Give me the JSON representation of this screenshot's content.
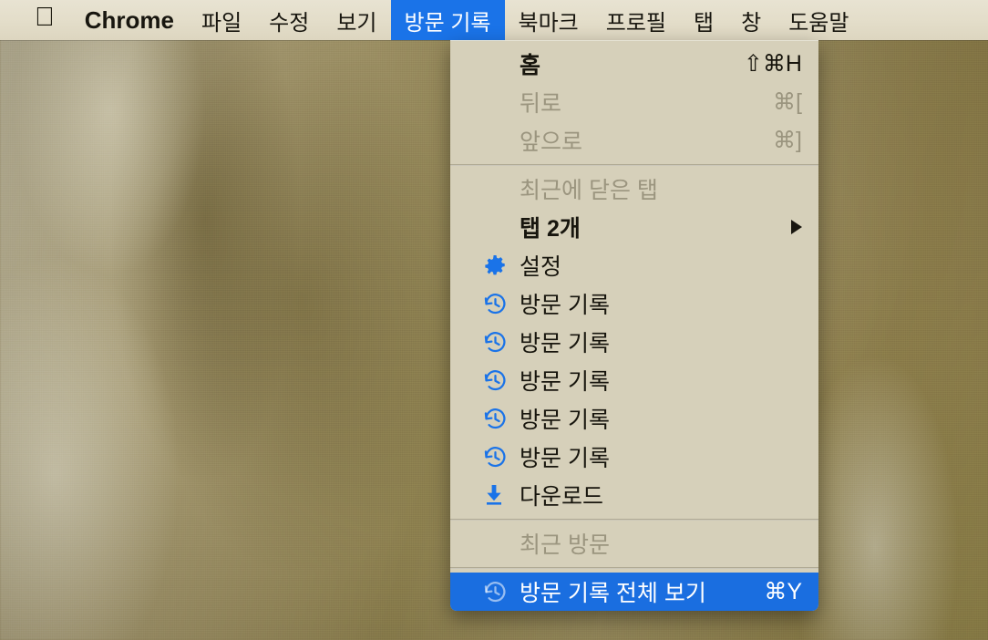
{
  "menubar": {
    "apple_icon": "apple-logo-icon",
    "items": [
      {
        "label": "Chrome",
        "bold": true,
        "active": false
      },
      {
        "label": "파일",
        "bold": false,
        "active": false
      },
      {
        "label": "수정",
        "bold": false,
        "active": false
      },
      {
        "label": "보기",
        "bold": false,
        "active": false
      },
      {
        "label": "방문 기록",
        "bold": false,
        "active": true
      },
      {
        "label": "북마크",
        "bold": false,
        "active": false
      },
      {
        "label": "프로필",
        "bold": false,
        "active": false
      },
      {
        "label": "탭",
        "bold": false,
        "active": false
      },
      {
        "label": "창",
        "bold": false,
        "active": false
      },
      {
        "label": "도움말",
        "bold": false,
        "active": false
      }
    ]
  },
  "menu": {
    "accent_color": "#1a73e8",
    "highlight_color": "#1a6ee0",
    "background_color": "#d6d0ba",
    "rows": [
      {
        "label": "홈",
        "shortcut": "⇧⌘H",
        "bold": true,
        "disabled": false,
        "icon": "",
        "arrow": false,
        "highlight": false
      },
      {
        "label": "뒤로",
        "shortcut": "⌘[",
        "bold": false,
        "disabled": true,
        "icon": "",
        "arrow": false,
        "highlight": false
      },
      {
        "label": "앞으로",
        "shortcut": "⌘]",
        "bold": false,
        "disabled": true,
        "icon": "",
        "arrow": false,
        "highlight": false
      },
      {
        "separator": true
      },
      {
        "label": "최근에 닫은 탭",
        "shortcut": "",
        "bold": false,
        "disabled": true,
        "icon": "",
        "arrow": false,
        "highlight": false
      },
      {
        "label": "탭 2개",
        "shortcut": "",
        "bold": true,
        "disabled": false,
        "icon": "",
        "arrow": true,
        "highlight": false
      },
      {
        "label": "설정",
        "shortcut": "",
        "bold": false,
        "disabled": false,
        "icon": "gear-icon",
        "arrow": false,
        "highlight": false
      },
      {
        "label": "방문 기록",
        "shortcut": "",
        "bold": false,
        "disabled": false,
        "icon": "history-icon",
        "arrow": false,
        "highlight": false
      },
      {
        "label": "방문 기록",
        "shortcut": "",
        "bold": false,
        "disabled": false,
        "icon": "history-icon",
        "arrow": false,
        "highlight": false
      },
      {
        "label": "방문 기록",
        "shortcut": "",
        "bold": false,
        "disabled": false,
        "icon": "history-icon",
        "arrow": false,
        "highlight": false
      },
      {
        "label": "방문 기록",
        "shortcut": "",
        "bold": false,
        "disabled": false,
        "icon": "history-icon",
        "arrow": false,
        "highlight": false
      },
      {
        "label": "방문 기록",
        "shortcut": "",
        "bold": false,
        "disabled": false,
        "icon": "history-icon",
        "arrow": false,
        "highlight": false
      },
      {
        "label": "다운로드",
        "shortcut": "",
        "bold": false,
        "disabled": false,
        "icon": "download-icon",
        "arrow": false,
        "highlight": false
      },
      {
        "separator": true
      },
      {
        "label": "최근 방문",
        "shortcut": "",
        "bold": false,
        "disabled": true,
        "icon": "",
        "arrow": false,
        "highlight": false
      },
      {
        "separator": true
      },
      {
        "label": "방문 기록 전체 보기",
        "shortcut": "⌘Y",
        "bold": false,
        "disabled": false,
        "icon": "history-icon",
        "arrow": false,
        "highlight": true
      }
    ]
  },
  "desktop": {
    "wallpaper_description": "blurred olive and tan abstract wallpaper"
  }
}
